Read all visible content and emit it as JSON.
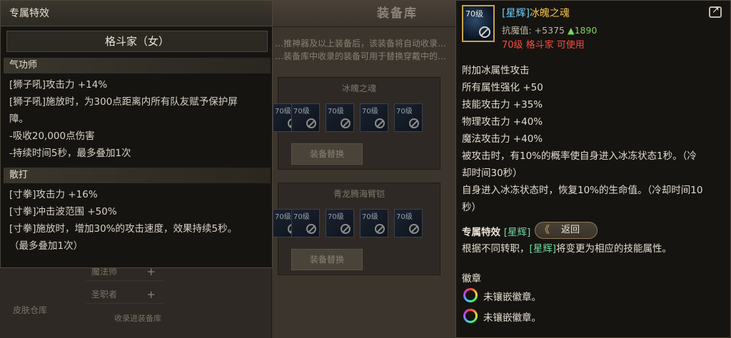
{
  "background_window": {
    "title": "装备库",
    "notice_lines": [
      "…推神器及以上装备后，该装备将自动收录…",
      "…装备库中收录的装备可用于替换穿戴中的…"
    ],
    "panels": [
      {
        "title": "冰魄之魂",
        "slot_level": "70级",
        "button": "装备替换"
      },
      {
        "title": "青龙腾海臂铠",
        "slot_level": "70级",
        "button": "装备替换"
      }
    ],
    "categories": [
      "魔法师",
      "圣职者"
    ],
    "side_items": [
      "皮肤仓库"
    ],
    "bottom_item": "收录进装备库"
  },
  "left_tooltip": {
    "header": "专属特效",
    "class_name": "格斗家（女）",
    "sections": [
      {
        "name": "气功师",
        "lines": [
          "[狮子吼]攻击力 +14%",
          "[狮子吼]施放时，为300点距离内所有队友赋予保护屏",
          "障。",
          "-吸收20,000点伤害",
          "-持续时间5秒，最多叠加1次"
        ]
      },
      {
        "name": "散打",
        "lines": [
          "[寸拳]攻击力 +16%",
          "[寸拳]冲击波范围 +50%",
          "[寸拳]施放时，增加30%的攻击速度，效果持续5秒。",
          "（最多叠加1次）"
        ]
      }
    ]
  },
  "item_tooltip": {
    "icon_level": "70级",
    "rarity": "[星辉]",
    "name": "冰魄之魂",
    "resist_label": "抗魔值: +5375",
    "resist_up": "▲1890",
    "requirement": "70级 格斗家 可使用",
    "stats": [
      "附加冰属性攻击",
      "所有属性强化 +50",
      "技能攻击力 +35%",
      "物理攻击力 +40%",
      "魔法攻击力 +40%",
      "被攻击时，有10%的概率使自身进入冰冻状态1秒。（冷",
      "却时间30秒）",
      "自身进入冰冻状态时，恢复10%的生命值。（冷却时间10",
      "秒）"
    ],
    "exclusive_title": "专属特效",
    "exclusive_tag": "[星辉]",
    "back_button": "返回",
    "exclusive_desc_prefix": "根据不同转职，",
    "exclusive_desc_tag": "[星辉]",
    "exclusive_desc_suffix": "将变更为相应的技能属性。",
    "emblem_title": "徽章",
    "emblems": [
      "未镶嵌徽章。",
      "未镶嵌徽章。"
    ]
  },
  "colors": {
    "rarity_cyan": "#6fd0ff",
    "item_gold": "#f2c14a",
    "requirement_red": "#ff4a3d",
    "resist_green": "#7bd65a",
    "tag_green": "#6fd7a0"
  }
}
